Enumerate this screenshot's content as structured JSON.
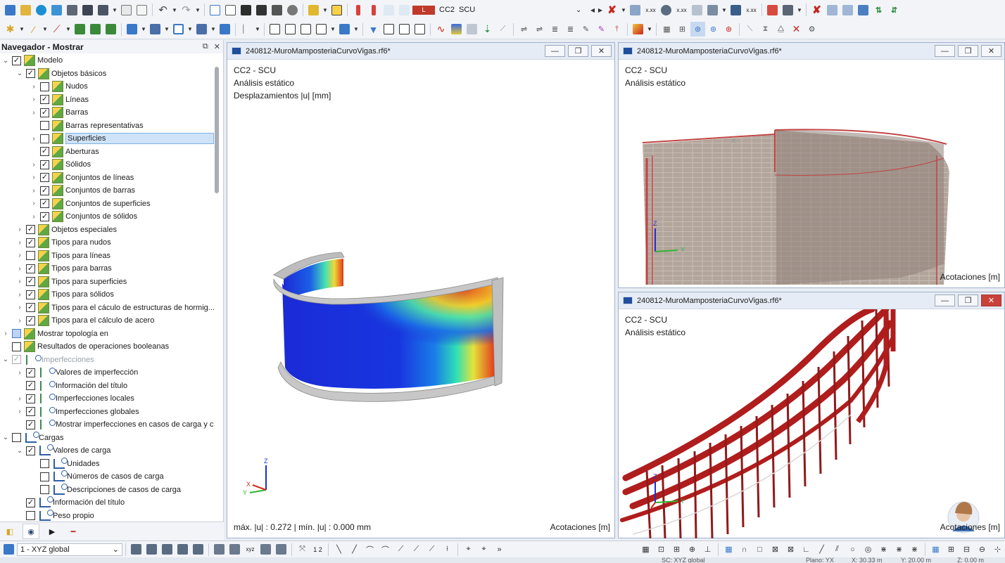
{
  "toolbar_top": {
    "load_case_code": "CC2",
    "load_case_name": "SCU",
    "load_case_color": "#c0392b",
    "load_case_badge": "L"
  },
  "navigator": {
    "title": "Navegador - Mostrar",
    "items": [
      {
        "label": "Modelo",
        "level": 0,
        "expand": "v",
        "check": "on",
        "icon": "chk"
      },
      {
        "label": "Objetos básicos",
        "level": 1,
        "expand": "v",
        "check": "on",
        "icon": "chk"
      },
      {
        "label": "Nudos",
        "level": 2,
        "expand": ">",
        "check": "off",
        "icon": "chk"
      },
      {
        "label": "Líneas",
        "level": 2,
        "expand": ">",
        "check": "on",
        "icon": "chk"
      },
      {
        "label": "Barras",
        "level": 2,
        "expand": ">",
        "check": "on",
        "icon": "chk"
      },
      {
        "label": "Barras representativas",
        "level": 2,
        "expand": "",
        "check": "off",
        "icon": "chk"
      },
      {
        "label": "Superficies",
        "level": 2,
        "expand": ">",
        "check": "off",
        "icon": "chk",
        "selected": true
      },
      {
        "label": "Aberturas",
        "level": 2,
        "expand": "",
        "check": "on",
        "icon": "chk"
      },
      {
        "label": "Sólidos",
        "level": 2,
        "expand": ">",
        "check": "on",
        "icon": "chk"
      },
      {
        "label": "Conjuntos de líneas",
        "level": 2,
        "expand": ">",
        "check": "on",
        "icon": "chk"
      },
      {
        "label": "Conjuntos de barras",
        "level": 2,
        "expand": ">",
        "check": "on",
        "icon": "chk"
      },
      {
        "label": "Conjuntos de superficies",
        "level": 2,
        "expand": ">",
        "check": "on",
        "icon": "chk"
      },
      {
        "label": "Conjuntos de sólidos",
        "level": 2,
        "expand": ">",
        "check": "on",
        "icon": "chk"
      },
      {
        "label": "Objetos especiales",
        "level": 1,
        "expand": ">",
        "check": "on",
        "icon": "chk"
      },
      {
        "label": "Tipos para nudos",
        "level": 1,
        "expand": ">",
        "check": "on",
        "icon": "chk"
      },
      {
        "label": "Tipos para líneas",
        "level": 1,
        "expand": ">",
        "check": "off",
        "icon": "chk"
      },
      {
        "label": "Tipos para barras",
        "level": 1,
        "expand": ">",
        "check": "on",
        "icon": "chk"
      },
      {
        "label": "Tipos para superficies",
        "level": 1,
        "expand": ">",
        "check": "on",
        "icon": "chk"
      },
      {
        "label": "Tipos para sólidos",
        "level": 1,
        "expand": ">",
        "check": "on",
        "icon": "chk"
      },
      {
        "label": "Tipos para el cáculo de estructuras de hormig...",
        "level": 1,
        "expand": ">",
        "check": "on",
        "icon": "chk"
      },
      {
        "label": "Tipos para el cálculo de acero",
        "level": 1,
        "expand": ">",
        "check": "on",
        "icon": "chk"
      },
      {
        "label": "Mostrar topología en",
        "level": 0,
        "expand": ">",
        "check": "part",
        "icon": "chk"
      },
      {
        "label": "Resultados de operaciones booleanas",
        "level": 0,
        "expand": "",
        "check": "off",
        "icon": "chk"
      },
      {
        "label": "Imperfecciones",
        "level": 0,
        "expand": "v",
        "check": "dis",
        "icon": "imp",
        "gray": true
      },
      {
        "label": "Valores de imperfección",
        "level": 1,
        "expand": ">",
        "check": "on",
        "icon": "imp"
      },
      {
        "label": "Información del título",
        "level": 1,
        "expand": "",
        "check": "on",
        "icon": "imp"
      },
      {
        "label": "Imperfecciones locales",
        "level": 1,
        "expand": ">",
        "check": "on",
        "icon": "imp"
      },
      {
        "label": "Imperfecciones globales",
        "level": 1,
        "expand": ">",
        "check": "on",
        "icon": "imp"
      },
      {
        "label": "Mostrar imperfecciones en casos de carga y c...",
        "level": 1,
        "expand": "",
        "check": "on",
        "icon": "imp"
      },
      {
        "label": "Cargas",
        "level": 0,
        "expand": "v",
        "check": "off",
        "icon": "ld"
      },
      {
        "label": "Valores de carga",
        "level": 1,
        "expand": "v",
        "check": "on",
        "icon": "ld"
      },
      {
        "label": "Unidades",
        "level": 2,
        "expand": "",
        "check": "off",
        "icon": "ld"
      },
      {
        "label": "Números de casos de carga",
        "level": 2,
        "expand": "",
        "check": "off",
        "icon": "ld"
      },
      {
        "label": "Descripciones de casos de carga",
        "level": 2,
        "expand": "",
        "check": "off",
        "icon": "ld"
      },
      {
        "label": "Información del título",
        "level": 1,
        "expand": "",
        "check": "on",
        "icon": "ld"
      },
      {
        "label": "Peso propio",
        "level": 1,
        "expand": "",
        "check": "off",
        "icon": "ld"
      }
    ]
  },
  "windows": {
    "w1": {
      "title": "240812-MuroMamposteriaCurvoVigas.rf6*",
      "line1": "CC2 - SCU",
      "line2": "Análisis estático",
      "line3": "Desplazamientos |u| [mm]",
      "footer_left": "máx. |u| : 0.272 | mín. |u| : 0.000 mm",
      "footer_right": "Acotaciones [m]"
    },
    "w2": {
      "title": "240812-MuroMamposteriaCurvoVigas.rf6*",
      "line1": "CC2 - SCU",
      "line2": "Análisis estático",
      "footer_right": "Acotaciones [m]"
    },
    "w3": {
      "title": "240812-MuroMamposteriaCurvoVigas.rf6*",
      "line1": "CC2 - SCU",
      "line2": "Análisis estático",
      "footer_right": "Acotaciones [m]"
    }
  },
  "axes": {
    "x": "X",
    "y": "Y",
    "z": "Z"
  },
  "statusbar": {
    "view_select": "1 - XYZ global",
    "coord_system": "SC: XYZ global",
    "plane": "Plano: YX",
    "x_coord": "X: 30.33 m",
    "y_coord": "Y: 20.00 m",
    "z_coord": "Z: 0.00 m"
  }
}
